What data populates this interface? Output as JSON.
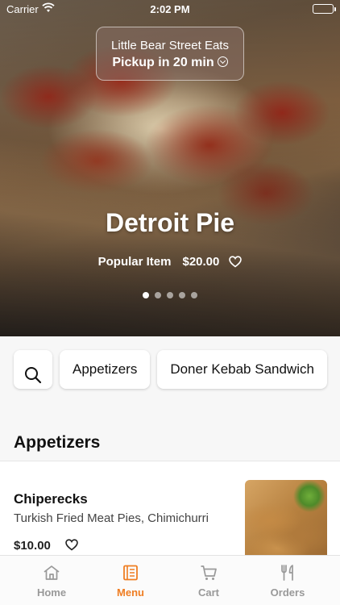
{
  "status_bar": {
    "carrier": "Carrier",
    "time": "2:02 PM"
  },
  "store": {
    "name": "Little Bear Street Eats",
    "pickup": "Pickup in 20 min"
  },
  "featured": {
    "title": "Detroit Pie",
    "badge": "Popular Item",
    "price": "$20.00",
    "slide_count": 5,
    "active_slide": 1
  },
  "categories": {
    "items": [
      "Appetizers",
      "Doner Kebab Sandwich"
    ]
  },
  "section": {
    "title": "Appetizers"
  },
  "menu_item": {
    "name": "Chiperecks",
    "description": "Turkish Fried Meat Pies, Chimichurri",
    "price": "$10.00"
  },
  "tabs": [
    {
      "label": "Home",
      "icon": "home-icon",
      "active": false
    },
    {
      "label": "Menu",
      "icon": "menu-book-icon",
      "active": true
    },
    {
      "label": "Cart",
      "icon": "cart-icon",
      "active": false
    },
    {
      "label": "Orders",
      "icon": "fork-knife-icon",
      "active": false
    }
  ],
  "colors": {
    "accent": "#ef7d22",
    "inactive_tab": "#999999"
  }
}
